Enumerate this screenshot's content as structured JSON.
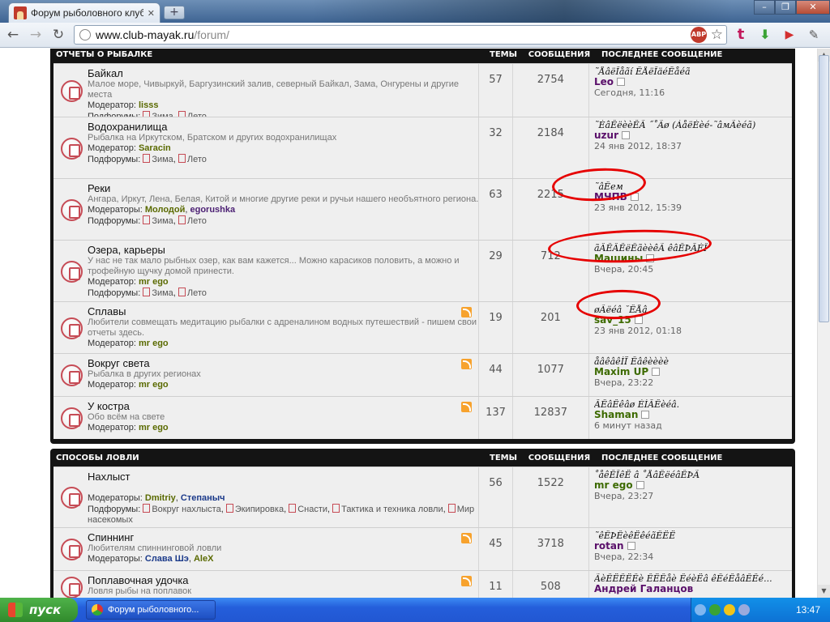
{
  "browser": {
    "tab_title": "Форум рыболовного клуба \"М",
    "url_host": "www.club-mayak.ru",
    "url_path": "/forum/",
    "abp": "ABP"
  },
  "blocks": [
    {
      "title": "Отчеты о рыбалке",
      "col_topics": "Темы",
      "col_posts": "Сообщения",
      "col_last": "Последнее сообщение",
      "forums": [
        {
          "name": "Байкал",
          "desc": "Малое море, Чивыркуй, Баргузинский залив, северный Байкал, Зама, Онгурены и другие места",
          "mod_label": "Модератор:",
          "mods": [
            "lisss"
          ],
          "sub_label": "Подфорумы:",
          "subs": [
            "Зима",
            "Лето"
          ],
          "rss": false,
          "topics": "57",
          "posts": "2754",
          "last_title": "˜ÅâëÎåãí ÊÅëÎäéÊåéã",
          "last_user": "Leo",
          "last_time": "Сегодня, 11:16"
        },
        {
          "name": "Водохранилища",
          "desc": "Рыбалка на Иркутском, Братском и других водохранилищах",
          "mod_label": "Модератор:",
          "mods": [
            "Saracin"
          ],
          "sub_label": "Подфорумы:",
          "subs": [
            "Зима",
            "Лето"
          ],
          "rss": false,
          "topics": "32",
          "posts": "2184",
          "last_title": "˜ÈâÊëèèÊÃ ˝˚Ãø (ÁåëÈèé-˜âмÃèéã)",
          "last_user": "uzur",
          "last_time": "24 янв 2012, 18:37"
        },
        {
          "name": "Реки",
          "desc": "Ангара, Иркут, Лена, Белая, Китой и многие другие реки и ручьи нашего необъятного региона.",
          "mod_label": "Модераторы:",
          "mods": [
            "Молодой",
            "egorushka"
          ],
          "sub_label": "Подфорумы:",
          "subs": [
            "Зима",
            "Лето"
          ],
          "rss": false,
          "topics": "63",
          "posts": "2215",
          "last_title": "˜âÊем",
          "last_user": "МЧПВ",
          "last_time": "23 янв 2012, 15:39"
        },
        {
          "name": "Озера, карьеры",
          "desc": "У нас не так мало рыбных озер, как вам кажется... Можно карасиков половить, а можно и трофейную щучку домой принести.",
          "mod_label": "Модератор:",
          "mods": [
            "mr ego"
          ],
          "sub_label": "Подфорумы:",
          "subs": [
            "Зима",
            "Лето"
          ],
          "rss": false,
          "topics": "29",
          "posts": "712",
          "last_title": "ãÂÊÂÊëÊãèèêÃ êâÊÞÂÈÎ",
          "last_user": "Машины",
          "last_time": "Вчера, 20:45"
        },
        {
          "name": "Сплавы",
          "desc": "Любители совмещать медитацию рыбалки с адреналином водных путешествий - пишем свои отчеты здесь.",
          "mod_label": "Модератор:",
          "mods": [
            "mr ego"
          ],
          "sub_label": "",
          "subs": [],
          "rss": true,
          "topics": "19",
          "posts": "201",
          "last_title": "øÃëéâ ˘ÊÅâ",
          "last_user": "sav_15",
          "last_time": "23 янв 2012, 01:18"
        },
        {
          "name": "Вокруг света",
          "desc": "Рыбалка в других регионах",
          "mod_label": "Модератор:",
          "mods": [
            "mr ego"
          ],
          "sub_label": "",
          "subs": [],
          "rss": true,
          "topics": "44",
          "posts": "1077",
          "last_title": "åâêâêÌÏ Êâêèèèè",
          "last_user": "Maxim UP",
          "last_time": "Вчера, 23:22"
        },
        {
          "name": "У костра",
          "desc": "Обо всём на свете",
          "mod_label": "Модератор:",
          "mods": [
            "mr ego"
          ],
          "sub_label": "",
          "subs": [],
          "rss": true,
          "topics": "137",
          "posts": "12837",
          "last_title": "ÂÊâÊêâø ÈÌÂÊèéâ.",
          "last_user": "Shaman",
          "last_time": "6 минут назад"
        }
      ]
    },
    {
      "title": "Способы ловли",
      "col_topics": "Темы",
      "col_posts": "Сообщения",
      "col_last": "Последнее сообщение",
      "forums": [
        {
          "name": "Нахлыст",
          "desc": "",
          "mod_label": "Модераторы:",
          "mods": [
            "Dmitriy",
            "Степаныч"
          ],
          "sub_label": "Подфорумы:",
          "subs": [
            "Вокруг нахлыста",
            "Экипировка",
            "Снасти",
            "Тактика и техника ловли",
            "Мир насекомых"
          ],
          "rss": false,
          "topics": "56",
          "posts": "1522",
          "last_title": "˚åêÊÎêË â ˚ÅâÊëéâÊÞÃ",
          "last_user": "mr ego",
          "last_time": "Вчера, 23:27"
        },
        {
          "name": "Спиннинг",
          "desc": "Любителям спиннинговой ловли",
          "mod_label": "Модераторы:",
          "mods": [
            "Слава Шэ",
            "AleX"
          ],
          "sub_label": "",
          "subs": [],
          "rss": true,
          "topics": "45",
          "posts": "3718",
          "last_title": "˜êÊÞÊèêËêéãÊËË",
          "last_user": "rotan",
          "last_time": "Вчера, 22:34"
        },
        {
          "name": "Поплавочная удочка",
          "desc": "Ловля рыбы на поплавок",
          "mod_label": "",
          "mods": [],
          "sub_label": "",
          "subs": [],
          "rss": true,
          "topics": "11",
          "posts": "508",
          "last_title": "ÃèÊËÊËÊè ÊËÊåè ÊéèËâ êÊéÊåâÊÊé...",
          "last_user": "Андрей Галанцов",
          "last_time": ""
        }
      ]
    }
  ],
  "taskbar": {
    "start": "пуск",
    "task": "Форум рыболовного...",
    "lang": "RU",
    "clock": "13:47"
  },
  "colors": {
    "accent_red": "#e60000",
    "block_bg": "#141414",
    "row_bg": "#efefef",
    "mod_olive": "#5a6a00"
  }
}
